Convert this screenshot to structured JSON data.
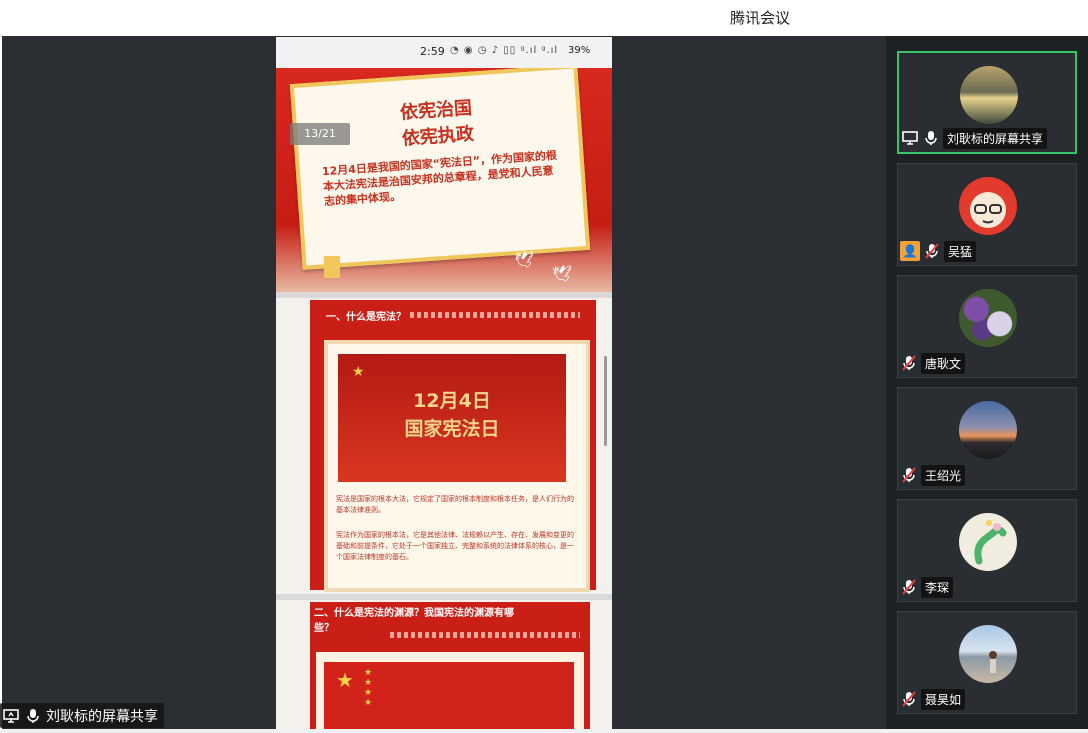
{
  "window": {
    "title": "腾讯会议"
  },
  "phone": {
    "status": {
      "time": "2:59",
      "icons": "◔ ◉ ◷ ♪ ▯▯ ᵍ.ıl ᵍ.ıl",
      "battery": "39%"
    },
    "slide1": {
      "counter": "13/21",
      "title_line1": "依宪治国",
      "title_line2": "依宪执政",
      "body": "12月4日是我国的国家“宪法日”，作为国家的根本大法宪法是治国安邦的总章程，是党和人民意志的集中体现。"
    },
    "slide2": {
      "heading": "一、什么是宪法？",
      "banner_line1": "12月4日",
      "banner_line2": "国家宪法日",
      "para1": "宪法是国家的根本大法，它规定了国家的根本制度和根本任务，是人们行为的基本法律准则。",
      "para2": "宪法作为国家的根本法，它是其他法律、法规赖以产生、存在、发展和变更的基础和前提条件，它处于一个国家独立、完整和系统的法律体系的核心，是一个国家法律制度的基石。"
    },
    "slide3": {
      "heading": "二、什么是宪法的渊源？我国宪法的渊源有哪些？"
    }
  },
  "sharer_label": "刘耿标的屏幕共享",
  "participants": [
    {
      "name": "刘耿标的屏幕共享",
      "active": true,
      "mic": "on",
      "share": true
    },
    {
      "name": "吴猛",
      "mic": "muted",
      "user_badge": true
    },
    {
      "name": "唐耿文",
      "mic": "muted"
    },
    {
      "name": "王绍光",
      "mic": "muted"
    },
    {
      "name": "李琛",
      "mic": "muted"
    },
    {
      "name": "聂昊如",
      "mic": "muted"
    }
  ],
  "colors": {
    "active_border": "#35c56a",
    "accent_red": "#c91f16",
    "gold": "#f0c75a"
  }
}
